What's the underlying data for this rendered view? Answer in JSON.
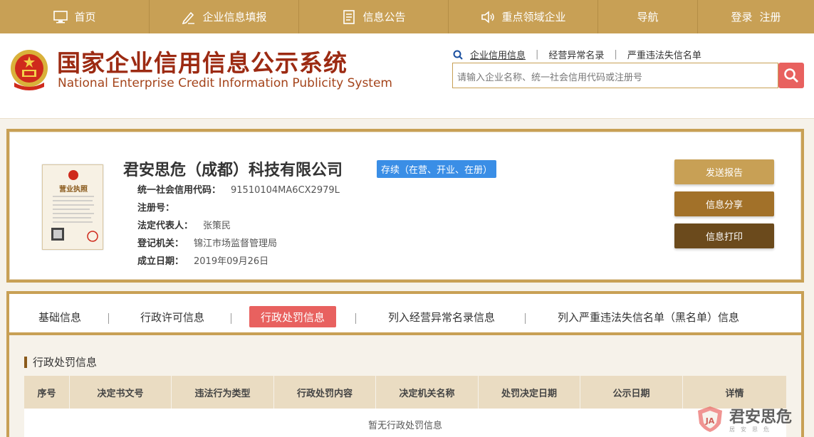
{
  "nav": {
    "items": [
      {
        "label": "首页",
        "icon": "monitor-icon"
      },
      {
        "label": "企业信息填报",
        "icon": "edit-icon"
      },
      {
        "label": "信息公告",
        "icon": "document-icon"
      },
      {
        "label": "重点领域企业",
        "icon": "speaker-icon"
      },
      {
        "label": "导航",
        "icon": ""
      }
    ],
    "login": "登录",
    "register": "注册"
  },
  "header": {
    "title_cn": "国家企业信用信息公示系统",
    "title_en": "National Enterprise Credit Information Publicity System",
    "search_tabs": [
      "企业信用信息",
      "经营异常名录",
      "严重违法失信名单"
    ],
    "search_placeholder": "请输入企业名称、统一社会信用代码或注册号"
  },
  "company": {
    "name": "君安思危（成都）科技有限公司",
    "status": "存续（在营、开业、在册）",
    "fields": [
      {
        "label": "统一社会信用代码：",
        "value": "91510104MA6CX2979L"
      },
      {
        "label": "注册号：",
        "value": ""
      },
      {
        "label": "法定代表人：",
        "value": "张策民"
      },
      {
        "label": "登记机关：",
        "value": "锦江市场监督管理局"
      },
      {
        "label": "成立日期：",
        "value": "2019年09月26日"
      }
    ],
    "buttons": {
      "send": "发送报告",
      "share": "信息分享",
      "print": "信息打印"
    },
    "license_title": "营业执照"
  },
  "tabs": [
    "基础信息",
    "行政许可信息",
    "行政处罚信息",
    "列入经营异常名录信息",
    "列入严重违法失信名单（黑名单）信息"
  ],
  "active_tab": "行政处罚信息",
  "section": {
    "title": "行政处罚信息",
    "columns": [
      "序号",
      "决定书文号",
      "违法行为类型",
      "行政处罚内容",
      "决定机关名称",
      "处罚决定日期",
      "公示日期",
      "详情"
    ],
    "empty": "暂无行政处罚信息"
  },
  "watermark": {
    "text": "君安思危",
    "sub": "居安思危"
  },
  "colors": {
    "gold": "#c8a055",
    "red": "#e8615f",
    "blue": "#3a8ee6",
    "title_red": "#9c2a12"
  }
}
